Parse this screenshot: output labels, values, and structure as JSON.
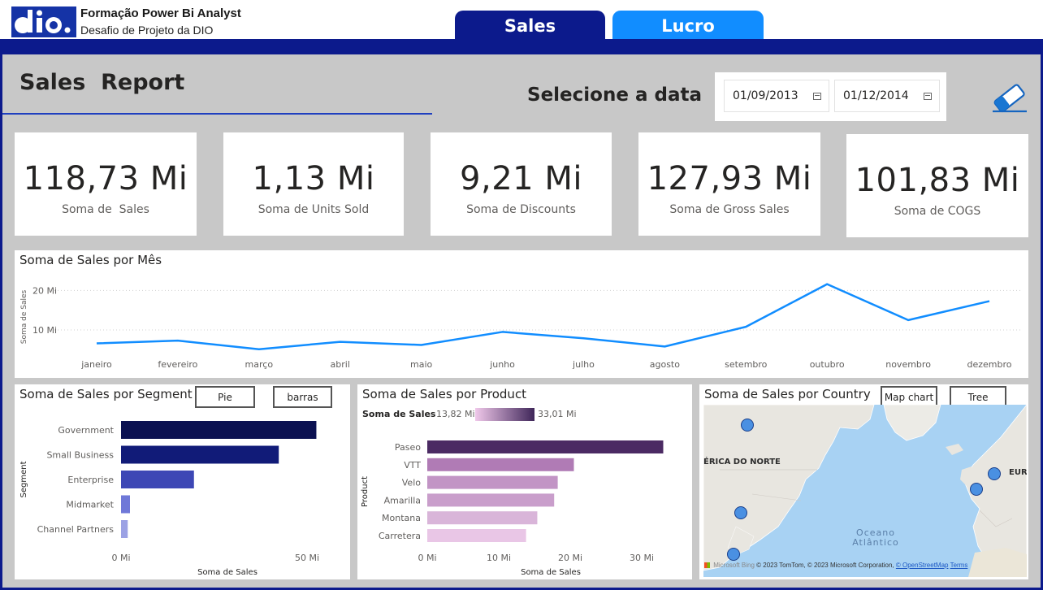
{
  "header": {
    "brand_title": "Formação Power Bi Analyst",
    "brand_subtitle": "Desafio de Projeto da DIO",
    "logo_text": "dio.",
    "tabs": [
      {
        "label": "Sales",
        "active": true
      },
      {
        "label": "Lucro",
        "active": false
      }
    ]
  },
  "report": {
    "title": "Sales  Report",
    "date_label": "Selecione a data",
    "date_from": "01/09/2013",
    "date_to": "01/12/2014",
    "clear_icon": "eraser-icon"
  },
  "kpis": [
    {
      "value": "118,73 Mi",
      "label": "Soma de  Sales"
    },
    {
      "value": "1,13 Mi",
      "label": "Soma de Units Sold"
    },
    {
      "value": "9,21 Mi",
      "label": "Soma de Discounts"
    },
    {
      "value": "127,93 Mi",
      "label": "Soma de Gross Sales"
    },
    {
      "value": "101,83 Mi",
      "label": "Soma de COGS"
    }
  ],
  "colors": {
    "navy": "#0c1a8c",
    "tab_blue": "#118dff",
    "line_blue": "#118dff",
    "canvas_gray": "#c8c8c8"
  },
  "segment_panel": {
    "buttons": [
      "Pie",
      "barras"
    ]
  },
  "country_panel": {
    "buttons": [
      "Map chart",
      "Tree"
    ],
    "labels": {
      "north_america": "ÉRICA DO NORTE",
      "europe": "EUR",
      "ocean_line1": "Oceano",
      "ocean_line2": "Atlântico"
    },
    "credit": "© 2023 TomTom, © 2023 Microsoft Corporation,",
    "credit_osm": "© OpenStreetMap",
    "credit_terms": "Terms",
    "bing_label": "Microsoft Bing"
  },
  "chart_data": [
    {
      "type": "line",
      "title": "Soma de Sales por Mês",
      "xlabel": "",
      "ylabel": "Soma de Sales",
      "categories": [
        "janeiro",
        "fevereiro",
        "março",
        "abril",
        "maio",
        "junho",
        "julho",
        "agosto",
        "setembro",
        "outubro",
        "novembro",
        "dezembro"
      ],
      "values": [
        6.6,
        7.3,
        5.1,
        7.0,
        6.2,
        9.5,
        7.9,
        5.8,
        10.8,
        21.6,
        12.5,
        17.3
      ],
      "ylim": [
        3,
        24
      ],
      "yticks": [
        10,
        20
      ],
      "ytick_labels": [
        "10 Mi",
        "20 Mi"
      ],
      "grid": true
    },
    {
      "type": "bar",
      "orientation": "horizontal",
      "title": "Soma de Sales por Segment",
      "xlabel": "Soma de Sales",
      "ylabel": "Segment",
      "categories": [
        "Government",
        "Small Business",
        "Enterprise",
        "Midmarket",
        "Channel Partners"
      ],
      "values": [
        52.5,
        42.4,
        19.6,
        2.4,
        1.8
      ],
      "colors": [
        "#0b1151",
        "#111b78",
        "#3d47b5",
        "#6f78d8",
        "#9ba1e4"
      ],
      "xlim": [
        0,
        60
      ],
      "xticks": [
        0,
        50
      ],
      "xtick_labels": [
        "0 Mi",
        "50 Mi"
      ]
    },
    {
      "type": "bar",
      "orientation": "horizontal",
      "title": "Soma de Sales por Product",
      "xlabel": "Soma de Sales",
      "ylabel": "Product",
      "categories": [
        "Paseo",
        "VTT",
        "Velo",
        "Amarilla",
        "Montana",
        "Carretera"
      ],
      "values": [
        33.01,
        20.51,
        18.25,
        17.75,
        15.39,
        13.82
      ],
      "colors": [
        "#4b2a63",
        "#b07bb5",
        "#c294c5",
        "#c99ecb",
        "#d9b5d9",
        "#e9c6e6"
      ],
      "xlim": [
        0,
        36
      ],
      "xticks": [
        0,
        10,
        20,
        30
      ],
      "xtick_labels": [
        "0 Mi",
        "10 Mi",
        "20 Mi",
        "30 Mi"
      ],
      "color_legend": {
        "title": "Soma de  Sales",
        "min_label": "13,82 Mi",
        "max_label": "33,01 Mi"
      }
    }
  ]
}
